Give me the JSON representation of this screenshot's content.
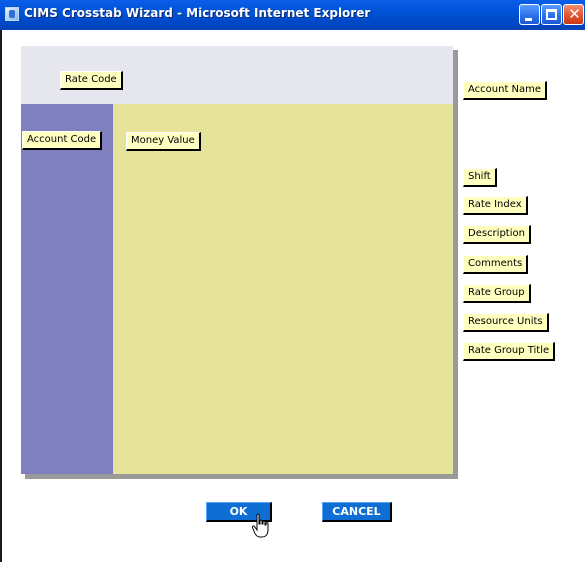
{
  "window": {
    "title": "CIMS Crosstab Wizard - Microsoft Internet Explorer",
    "minimize_icon": "minimize-icon",
    "maximize_icon": "maximize-icon",
    "close_icon": "close-icon",
    "close_glyph": "✕"
  },
  "crosstab": {
    "column_field": "Rate Code",
    "row_field": "Account Code",
    "value_field": "Money Value"
  },
  "available_fields": [
    "Account Name",
    "Shift",
    "Rate Index",
    "Description",
    "Comments",
    "Rate Group",
    "Resource Units",
    "Rate Group Title"
  ],
  "buttons": {
    "ok": "OK",
    "cancel": "CANCEL"
  },
  "colors": {
    "titlebar": "#0052d6",
    "column_area": "#e6e6ee",
    "row_area": "#8080bf",
    "data_area": "#e6e39b",
    "field_chip": "#ffffc0",
    "button": "#0e6ed4"
  }
}
